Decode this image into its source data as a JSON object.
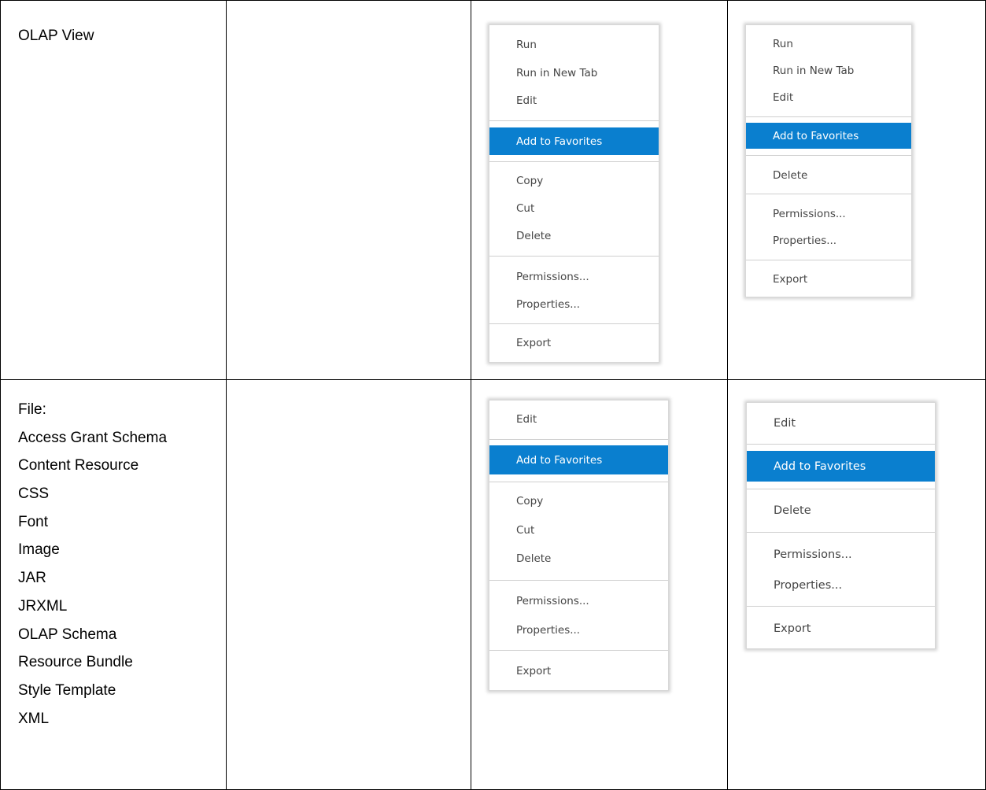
{
  "rows": [
    {
      "type_label": "OLAP View",
      "file_types": [],
      "menu_a": {
        "items": [
          "Run",
          "Run in New Tab",
          "Edit",
          "Add to Favorites",
          "Copy",
          "Cut",
          "Delete",
          "Permissions...",
          "Properties...",
          "Export"
        ],
        "highlighted": "Add to Favorites"
      },
      "menu_b": {
        "items": [
          "Run",
          "Run in New Tab",
          "Edit",
          "Add to Favorites",
          "Delete",
          "Permissions...",
          "Properties...",
          "Export"
        ],
        "highlighted": "Add to Favorites"
      }
    },
    {
      "type_label": "File:",
      "file_types": [
        "Access Grant Schema",
        "Content Resource",
        "CSS",
        "Font",
        "Image",
        "JAR",
        "JRXML",
        "OLAP Schema",
        "Resource Bundle",
        "Style Template",
        "XML"
      ],
      "menu_a": {
        "items": [
          "Edit",
          "Add to Favorites",
          "Copy",
          "Cut",
          "Delete",
          "Permissions...",
          "Properties...",
          "Export"
        ],
        "highlighted": "Add to Favorites"
      },
      "menu_b": {
        "items": [
          "Edit",
          "Add to Favorites",
          "Delete",
          "Permissions...",
          "Properties...",
          "Export"
        ],
        "highlighted": "Add to Favorites"
      }
    }
  ],
  "colors": {
    "highlight": "#0a7fcf",
    "menu_text": "#454545",
    "border": "#000000"
  }
}
